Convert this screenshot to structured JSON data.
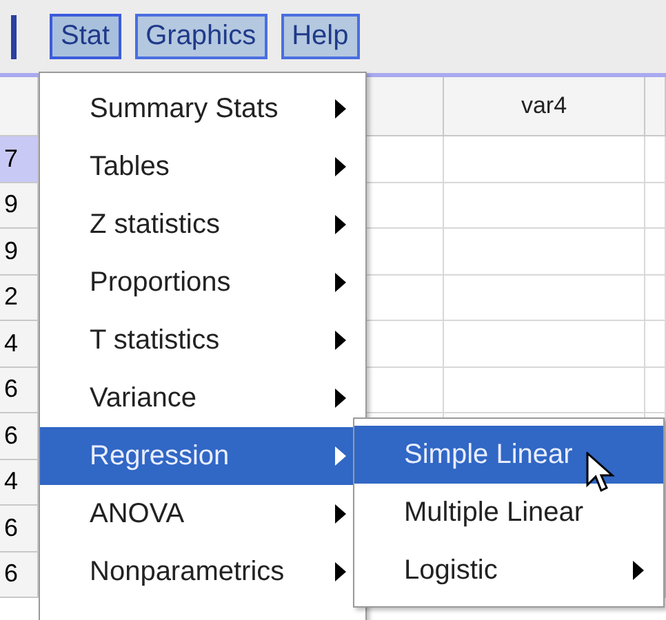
{
  "menu_bar": [
    {
      "label": "Stat",
      "open": true
    },
    {
      "label": "Graphics",
      "open": false
    },
    {
      "label": "Help",
      "open": false
    }
  ],
  "table": {
    "columns": [
      "",
      "var4",
      ""
    ],
    "row_numbers": [
      {
        "label": "7",
        "selected": true
      },
      {
        "label": "9",
        "selected": false
      },
      {
        "label": "9",
        "selected": false
      },
      {
        "label": "2",
        "selected": false
      },
      {
        "label": "4",
        "selected": false
      },
      {
        "label": "6",
        "selected": false
      },
      {
        "label": "6",
        "selected": false
      },
      {
        "label": "4",
        "selected": false
      },
      {
        "label": "6",
        "selected": false
      },
      {
        "label": "6",
        "selected": false
      }
    ]
  },
  "stat_menu": [
    {
      "label": "Summary Stats",
      "submenu": true,
      "selected": false
    },
    {
      "label": "Tables",
      "submenu": true,
      "selected": false
    },
    {
      "label": "Z statistics",
      "submenu": true,
      "selected": false
    },
    {
      "label": "Proportions",
      "submenu": true,
      "selected": false
    },
    {
      "label": "T statistics",
      "submenu": true,
      "selected": false
    },
    {
      "label": "Variance",
      "submenu": true,
      "selected": false
    },
    {
      "label": "Regression",
      "submenu": true,
      "selected": true
    },
    {
      "label": "ANOVA",
      "submenu": true,
      "selected": false
    },
    {
      "label": "Nonparametrics",
      "submenu": true,
      "selected": false
    }
  ],
  "regression_submenu": [
    {
      "label": "Simple Linear",
      "submenu": false,
      "selected": true
    },
    {
      "label": "Multiple Linear",
      "submenu": false,
      "selected": false
    },
    {
      "label": "Logistic",
      "submenu": true,
      "selected": false
    }
  ]
}
